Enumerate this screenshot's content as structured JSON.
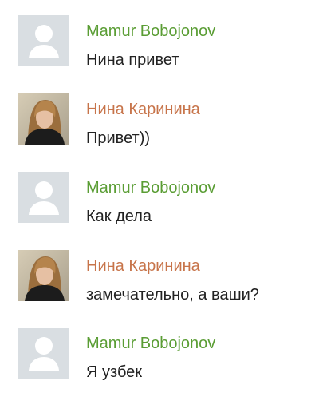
{
  "colors": {
    "mamur_name": "#5a9d34",
    "nina_name": "#c7744a",
    "message_text": "#222222",
    "placeholder_avatar_bg": "#d9dee2",
    "placeholder_avatar_figure": "#ffffff"
  },
  "messages": [
    {
      "author": "Mamur Bobojonov",
      "text": "Нина привет",
      "avatar": "default-user-avatar-icon"
    },
    {
      "author": "Нина Каринина",
      "text": "Привет))",
      "avatar": "user-photo"
    },
    {
      "author": "Mamur Bobojonov",
      "text": "Как дела",
      "avatar": "default-user-avatar-icon"
    },
    {
      "author": "Нина Каринина",
      "text": "замечательно, а ваши?",
      "avatar": "user-photo"
    },
    {
      "author": "Mamur Bobojonov",
      "text": "Я узбек",
      "avatar": "default-user-avatar-icon"
    }
  ]
}
